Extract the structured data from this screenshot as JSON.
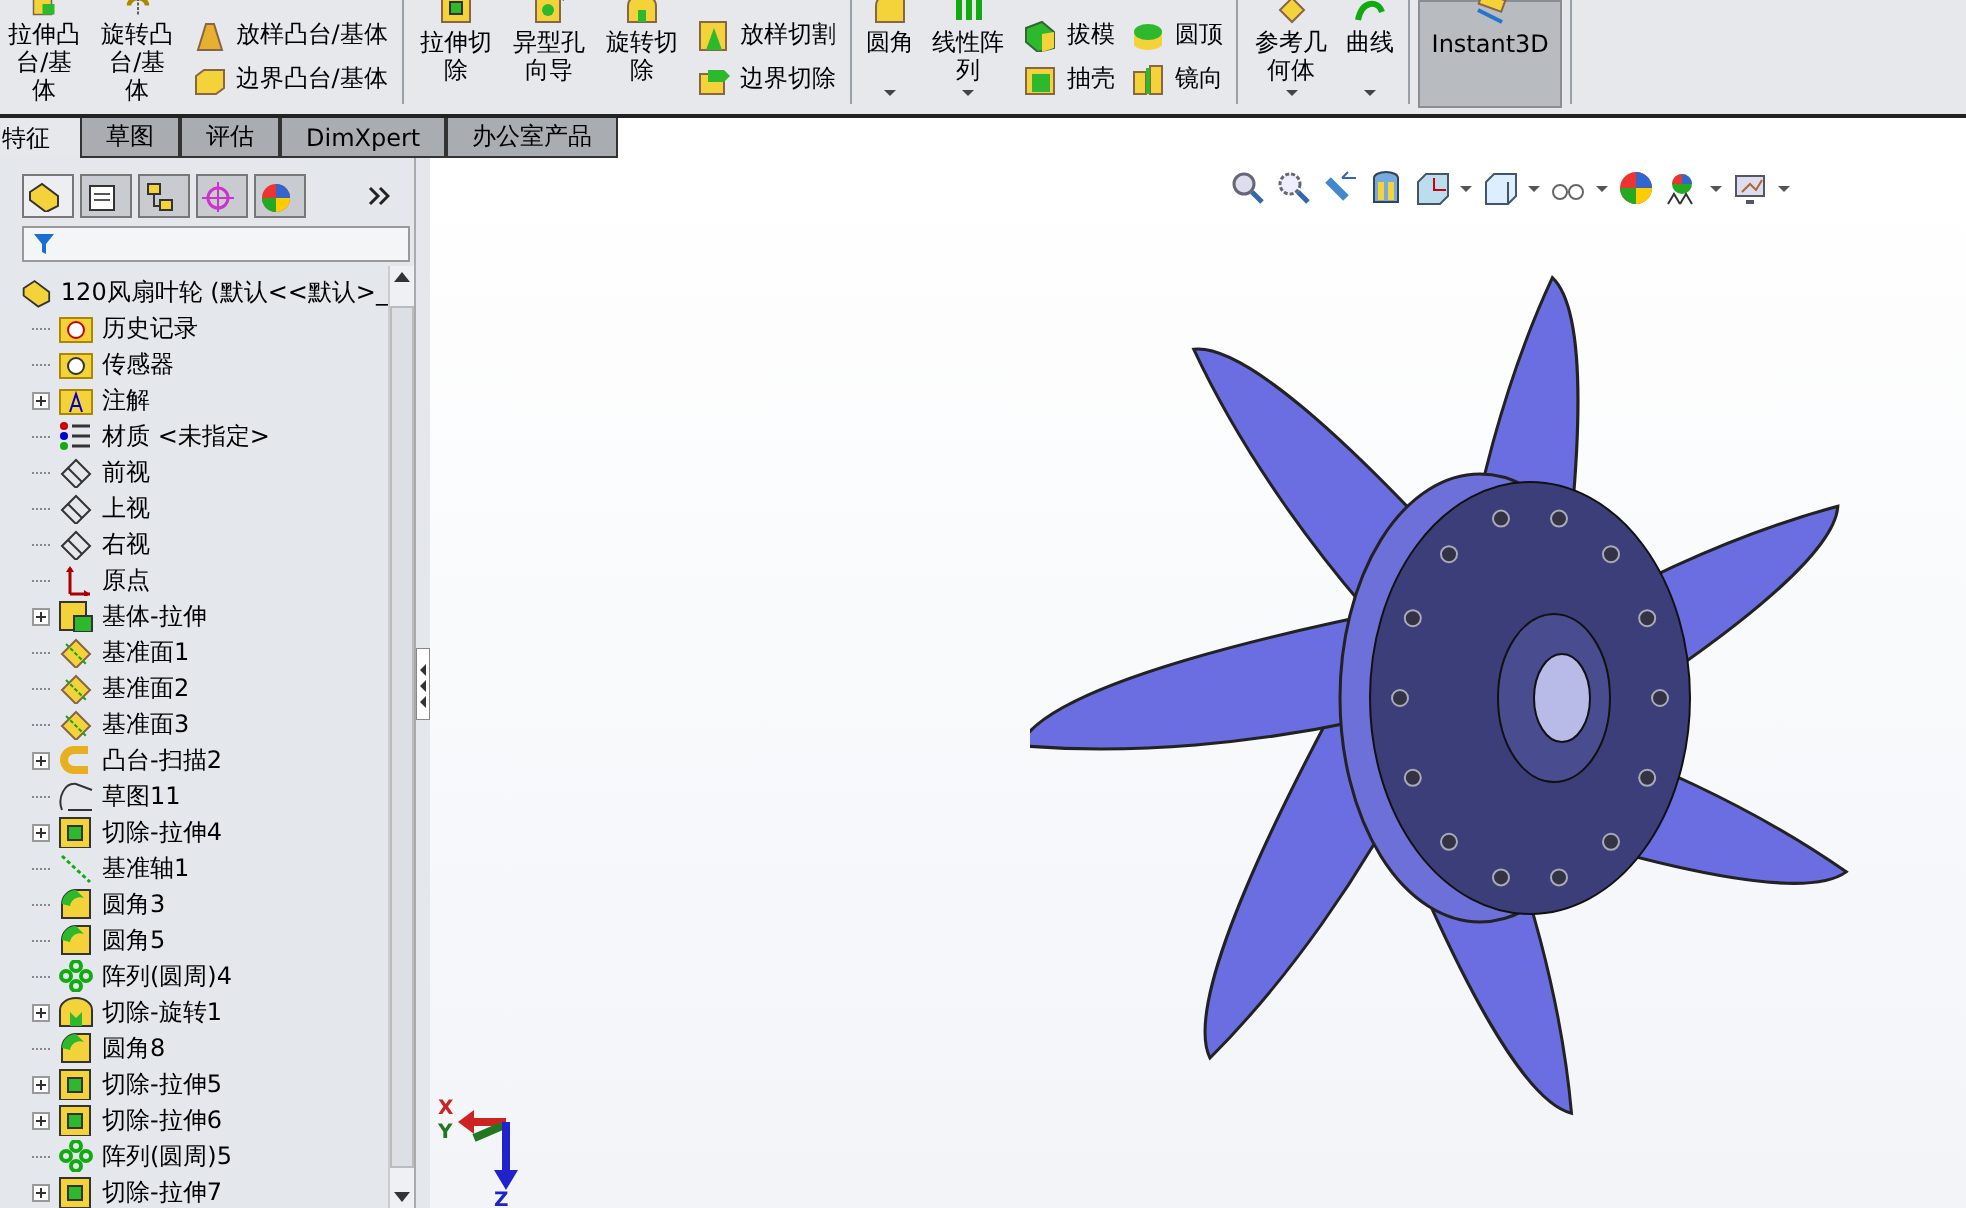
{
  "toolbar": {
    "groups": [
      {
        "large": [
          {
            "label": "拉伸凸台/基体",
            "kind": "extrude-boss"
          },
          {
            "label": "旋转凸台/基体",
            "kind": "revolve-boss"
          }
        ],
        "small": [
          {
            "label": "放样凸台/基体",
            "kind": "loft"
          },
          {
            "label": "边界凸台/基体",
            "kind": "boundary"
          }
        ]
      },
      {
        "large": [
          {
            "label": "拉伸切除",
            "kind": "extrude-cut"
          },
          {
            "label": "异型孔向导",
            "kind": "hole"
          },
          {
            "label": "旋转切除",
            "kind": "revolve-cut"
          }
        ],
        "small": [
          {
            "label": "放样切割",
            "kind": "loft-cut"
          },
          {
            "label": "边界切除",
            "kind": "boundary-cut"
          }
        ]
      },
      {
        "large": [
          {
            "label": "圆角",
            "kind": "fillet",
            "dropdown": true
          },
          {
            "label": "线性阵列",
            "kind": "pattern",
            "dropdown": true
          }
        ],
        "small": [
          {
            "label": "拔模",
            "kind": "draft"
          },
          {
            "label": "抽壳",
            "kind": "shell"
          },
          {
            "label": "圆顶",
            "kind": "dome"
          },
          {
            "label": "镜向",
            "kind": "mirror"
          }
        ]
      },
      {
        "large": [
          {
            "label": "参考几何体",
            "kind": "refgeom",
            "dropdown": true
          },
          {
            "label": "曲线",
            "kind": "curve",
            "dropdown": true
          }
        ]
      },
      {
        "large": [
          {
            "label": "Instant3D",
            "kind": "instant3d",
            "pressed": true
          }
        ]
      }
    ]
  },
  "tabs": [
    {
      "label": "特征",
      "selected": true
    },
    {
      "label": "草图",
      "selected": false
    },
    {
      "label": "评估",
      "selected": false
    },
    {
      "label": "DimXpert",
      "selected": false
    },
    {
      "label": "办公室产品",
      "selected": false
    }
  ],
  "panel_tabs": [
    {
      "kind": "feature-tree",
      "selected": true
    },
    {
      "kind": "property",
      "selected": false
    },
    {
      "kind": "config",
      "selected": false
    },
    {
      "kind": "dimxpert",
      "selected": false
    },
    {
      "kind": "display",
      "selected": false
    }
  ],
  "tree": {
    "root": "120风扇叶轮 (默认<<默认>_",
    "children": [
      {
        "label": "历史记录",
        "kind": "history",
        "collapsed": false
      },
      {
        "label": "传感器",
        "kind": "sensor",
        "collapsed": false
      },
      {
        "label": "注解",
        "kind": "annotation",
        "collapsed": true
      },
      {
        "label": "材质 <未指定>",
        "kind": "material",
        "collapsed": false
      },
      {
        "label": "前视",
        "kind": "plane",
        "collapsed": false
      },
      {
        "label": "上视",
        "kind": "plane",
        "collapsed": false
      },
      {
        "label": "右视",
        "kind": "plane",
        "collapsed": false
      },
      {
        "label": "原点",
        "kind": "origin",
        "collapsed": false
      },
      {
        "label": "基体-拉伸",
        "kind": "extrude",
        "collapsed": true
      },
      {
        "label": "基准面1",
        "kind": "refplane",
        "collapsed": false
      },
      {
        "label": "基准面2",
        "kind": "refplane",
        "collapsed": false
      },
      {
        "label": "基准面3",
        "kind": "refplane",
        "collapsed": false
      },
      {
        "label": "凸台-扫描2",
        "kind": "sweep",
        "collapsed": true
      },
      {
        "label": "草图11",
        "kind": "sketch",
        "collapsed": false
      },
      {
        "label": "切除-拉伸4",
        "kind": "cut",
        "collapsed": true
      },
      {
        "label": "基准轴1",
        "kind": "axis",
        "collapsed": false
      },
      {
        "label": "圆角3",
        "kind": "fillet",
        "collapsed": false
      },
      {
        "label": "圆角5",
        "kind": "fillet",
        "collapsed": false
      },
      {
        "label": "阵列(圆周)4",
        "kind": "pattern",
        "collapsed": false
      },
      {
        "label": "切除-旋转1",
        "kind": "revcut",
        "collapsed": true
      },
      {
        "label": "圆角8",
        "kind": "fillet",
        "collapsed": false
      },
      {
        "label": "切除-拉伸5",
        "kind": "cut",
        "collapsed": true
      },
      {
        "label": "切除-拉伸6",
        "kind": "cut",
        "collapsed": true
      },
      {
        "label": "阵列(圆周)5",
        "kind": "pattern",
        "collapsed": false
      },
      {
        "label": "切除-拉伸7",
        "kind": "cut",
        "collapsed": true
      }
    ]
  },
  "view_toolbar": [
    {
      "kind": "zoom-fit",
      "dropdown": false
    },
    {
      "kind": "zoom-area",
      "dropdown": false
    },
    {
      "kind": "previous-view",
      "dropdown": false
    },
    {
      "kind": "section",
      "dropdown": false
    },
    {
      "kind": "view-orient",
      "dropdown": true
    },
    {
      "kind": "display-style",
      "dropdown": true
    },
    {
      "kind": "hide-show",
      "dropdown": true
    },
    {
      "kind": "appearance",
      "dropdown": false
    },
    {
      "kind": "scene",
      "dropdown": true
    },
    {
      "kind": "view-settings",
      "dropdown": true
    }
  ],
  "triad": {
    "x": "X",
    "y": "Y",
    "z": "Z"
  }
}
